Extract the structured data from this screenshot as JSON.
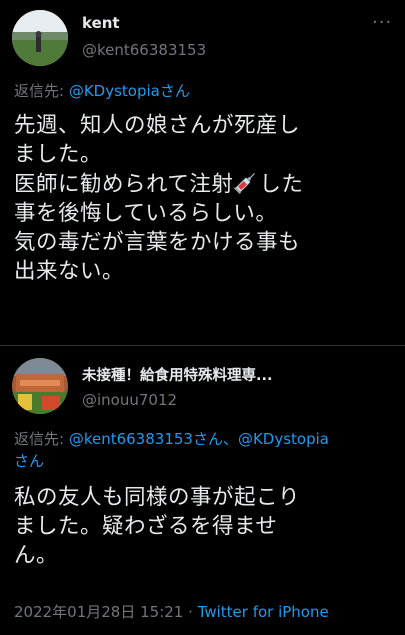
{
  "tweet1": {
    "name": "kent",
    "handle": "@kent66383153",
    "reply_prefix": "返信先: ",
    "reply_to": "@KDystopiaさん",
    "text_part1": "先週、知人の娘さんが死産し\nました。\n医師に勧められて注射",
    "emoji": "syringe-emoji",
    "text_part2": "した\n事を後悔しているらしい。\n気の毒だが言葉をかける事も\n出来ない。"
  },
  "tweet2": {
    "name": "未接種！給食用特殊料理専...",
    "handle": "@inouu7012",
    "reply_prefix": "返信先: ",
    "reply_to_1": "@kent66383153さん",
    "reply_sep": "、",
    "reply_to_2": "@KDystopia",
    "reply_suffix": "さん",
    "text": "私の友人も同様の事が起こり\nました。疑わざるを得ませ\nん。",
    "date": "2022年01月28日 15:21",
    "dot": " · ",
    "source": "Twitter for iPhone"
  },
  "colors": {
    "background": "#000000",
    "text": "#e7e9ea",
    "secondary": "#71767b",
    "link": "#1d9bf0",
    "divider": "#2f3336"
  }
}
